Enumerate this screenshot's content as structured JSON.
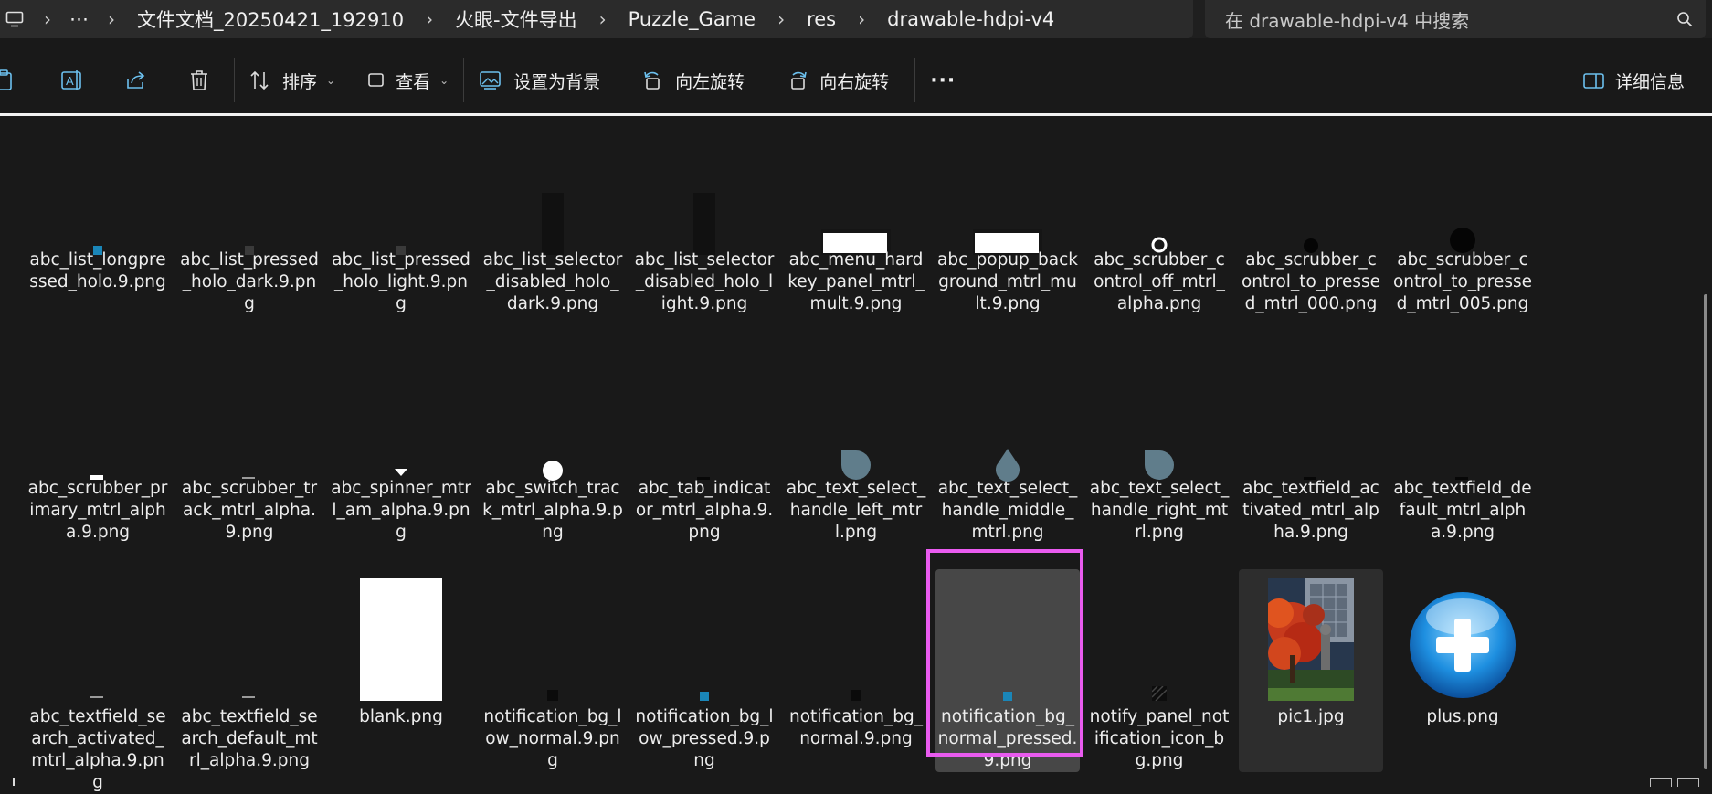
{
  "breadcrumb": {
    "overflow": "⋯",
    "segments": [
      "文件文档_20250421_192910",
      "火眼-文件导出",
      "Puzzle_Game",
      "res",
      "drawable-hdpi-v4"
    ]
  },
  "search": {
    "placeholder": "在 drawable-hdpi-v4 中搜索"
  },
  "toolbar": {
    "sort": "排序",
    "view": "查看",
    "set_background": "设置为背景",
    "rotate_left": "向左旋转",
    "rotate_right": "向右旋转",
    "more": "···",
    "details": "详细信息"
  },
  "files": [
    {
      "name": "abc_list_longpressed_holo.9.png",
      "icon": "small-teal-square"
    },
    {
      "name": "abc_list_pressed_holo_dark.9.png",
      "icon": "tiny-dark-square"
    },
    {
      "name": "abc_list_pressed_holo_light.9.png",
      "icon": "tiny-dark-square"
    },
    {
      "name": "abc_list_selector_disabled_holo_dark.9.png",
      "icon": "tall-dark-bar"
    },
    {
      "name": "abc_list_selector_disabled_holo_light.9.png",
      "icon": "tall-dark-bar"
    },
    {
      "name": "abc_menu_hardkey_panel_mtrl_mult.9.png",
      "icon": "white-panel"
    },
    {
      "name": "abc_popup_background_mtrl_mult.9.png",
      "icon": "white-panel"
    },
    {
      "name": "abc_scrubber_control_off_mtrl_alpha.png",
      "icon": "ring"
    },
    {
      "name": "abc_scrubber_control_to_pressed_mtrl_000.png",
      "icon": "black-dot"
    },
    {
      "name": "abc_scrubber_control_to_pressed_mtrl_005.png",
      "icon": "black-circle"
    },
    {
      "name": "abc_scrubber_primary_mtrl_alpha.9.png",
      "icon": "white-dash"
    },
    {
      "name": "abc_scrubber_track_mtrl_alpha.9.png",
      "icon": "gray-dash"
    },
    {
      "name": "abc_spinner_mtrl_am_alpha.9.png",
      "icon": "white-triangle"
    },
    {
      "name": "abc_switch_track_mtrl_alpha.9.png",
      "icon": "white-pill"
    },
    {
      "name": "abc_tab_indicator_mtrl_alpha.9.png",
      "icon": "dark-dash"
    },
    {
      "name": "abc_text_select_handle_left_mtrl.png",
      "icon": "handle-left"
    },
    {
      "name": "abc_text_select_handle_middle_mtrl.png",
      "icon": "handle-middle"
    },
    {
      "name": "abc_text_select_handle_right_mtrl.png",
      "icon": "handle-right"
    },
    {
      "name": "abc_textfield_activated_mtrl_alpha.9.png",
      "icon": "dark-dash"
    },
    {
      "name": "abc_textfield_default_mtrl_alpha.9.png",
      "icon": "dark-dash"
    },
    {
      "name": "abc_textfield_search_activated_mtrl_alpha.9.png",
      "icon": "gray-dash"
    },
    {
      "name": "abc_textfield_search_default_mtrl_alpha.9.png",
      "icon": "gray-dash"
    },
    {
      "name": "blank.png",
      "icon": "white-page"
    },
    {
      "name": "notification_bg_low_normal.9.png",
      "icon": "tiny-black-square"
    },
    {
      "name": "notification_bg_low_pressed.9.png",
      "icon": "small-teal-square"
    },
    {
      "name": "notification_bg_normal.9.png",
      "icon": "tiny-black-square"
    },
    {
      "name": "notification_bg_normal_pressed.9.png",
      "icon": "small-teal-square",
      "state": "selected"
    },
    {
      "name": "notify_panel_notification_icon_bg.png",
      "icon": "hatched-square"
    },
    {
      "name": "pic1.jpg",
      "icon": "photo-autumn-tree",
      "state": "highlighted"
    },
    {
      "name": "plus.png",
      "icon": "blue-plus-orb"
    }
  ],
  "colors": {
    "background": "#191919",
    "selection": "#474747",
    "highlight_border": "#e95bef",
    "accent": "#4cc2ff"
  }
}
